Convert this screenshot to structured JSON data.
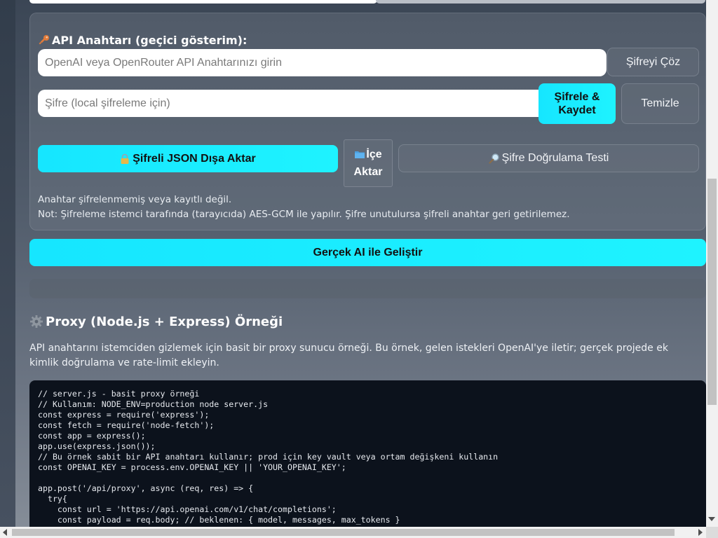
{
  "api_key_section": {
    "label": "API Anahtarı (geçici gösterim):",
    "key_input_placeholder": "OpenAI veya OpenRouter API Anahtarınızı girin",
    "decrypt_button": "Şifreyi Çöz",
    "password_input_placeholder": "Şifre (local şifreleme için)",
    "encrypt_save_line1": "Şifrele &",
    "encrypt_save_line2": "Kaydet",
    "clear_button": "Temizle",
    "export_button": "Şifreli JSON Dışa Aktar",
    "import_line1": "İçe",
    "import_line2": "Aktar",
    "verify_button": "Şifre Doğrulama Testi",
    "status": "Anahtar şifrelenmemiş veya kayıtlı değil.",
    "note": "Not: Şifreleme istemci tarafında (tarayıcıda) AES-GCM ile yapılır. Şifre unutulursa şifreli anahtar geri getirilemez."
  },
  "enhance_button": "Gerçek AI ile Geliştir",
  "proxy_section": {
    "title": "Proxy (Node.js + Express) Örneği",
    "description": "API anahtarını istemciden gizlemek için basit bir proxy sunucu örneği. Bu örnek, gelen istekleri OpenAI'ye iletir; gerçek projede ek kimlik doğrulama ve rate-limit ekleyin.",
    "code": "// server.js - basit proxy örneği\n// Kullanım: NODE_ENV=production node server.js\nconst express = require('express');\nconst fetch = require('node-fetch');\nconst app = express();\napp.use(express.json());\n// Bu örnek sabit bir API anahtarı kullanır; prod için key vault veya ortam değişkeni kullanın\nconst OPENAI_KEY = process.env.OPENAI_KEY || 'YOUR_OPENAI_KEY';\n\napp.post('/api/proxy', async (req, res) => {\n  try{\n    const url = 'https://api.openai.com/v1/chat/completions';\n    const payload = req.body; // beklenen: { model, messages, max_tokens }"
  },
  "icons": {
    "api_label": "key-icon",
    "export": "lock-icon",
    "import": "folder-icon",
    "verify": "magnifier-icon",
    "proxy_title": "gear-icon"
  },
  "colors": {
    "accent_cyan": "#16e6ff",
    "code_background": "#0c121c"
  }
}
